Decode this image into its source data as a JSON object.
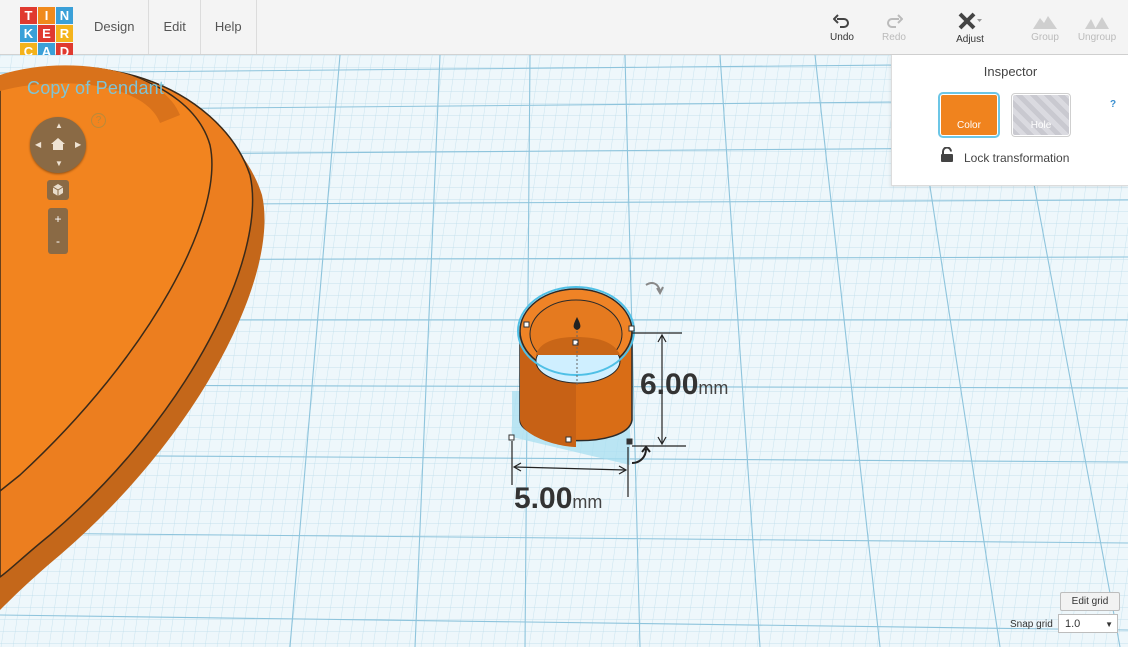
{
  "logo": {
    "letters": [
      "T",
      "I",
      "N",
      "K",
      "E",
      "R",
      "C",
      "A",
      "D"
    ]
  },
  "menu": {
    "items": [
      "Design",
      "Edit",
      "Help"
    ]
  },
  "toolbar": {
    "undo": "Undo",
    "redo": "Redo",
    "adjust": "Adjust",
    "group": "Group",
    "ungroup": "Ungroup"
  },
  "workplane": {
    "project_name": "Copy of Pendant",
    "help": "?",
    "zoom_in": "+",
    "zoom_out": "-"
  },
  "inspector": {
    "title": "Inspector",
    "color_label": "Color",
    "hole_label": "Hole",
    "help": "?",
    "lock_label": "Lock transformation",
    "color_value": "#f0831e"
  },
  "dimensions": {
    "height_value": "6.00",
    "height_unit": "mm",
    "width_value": "5.00",
    "width_unit": "mm"
  },
  "grid": {
    "edit_label": "Edit grid",
    "snap_label": "Snap grid",
    "snap_value": "1.0"
  },
  "colors": {
    "accent": "#f0831e",
    "selection": "#6cc6e6",
    "grid_line": "#a8d4e6",
    "nav": "#8a6a45"
  }
}
